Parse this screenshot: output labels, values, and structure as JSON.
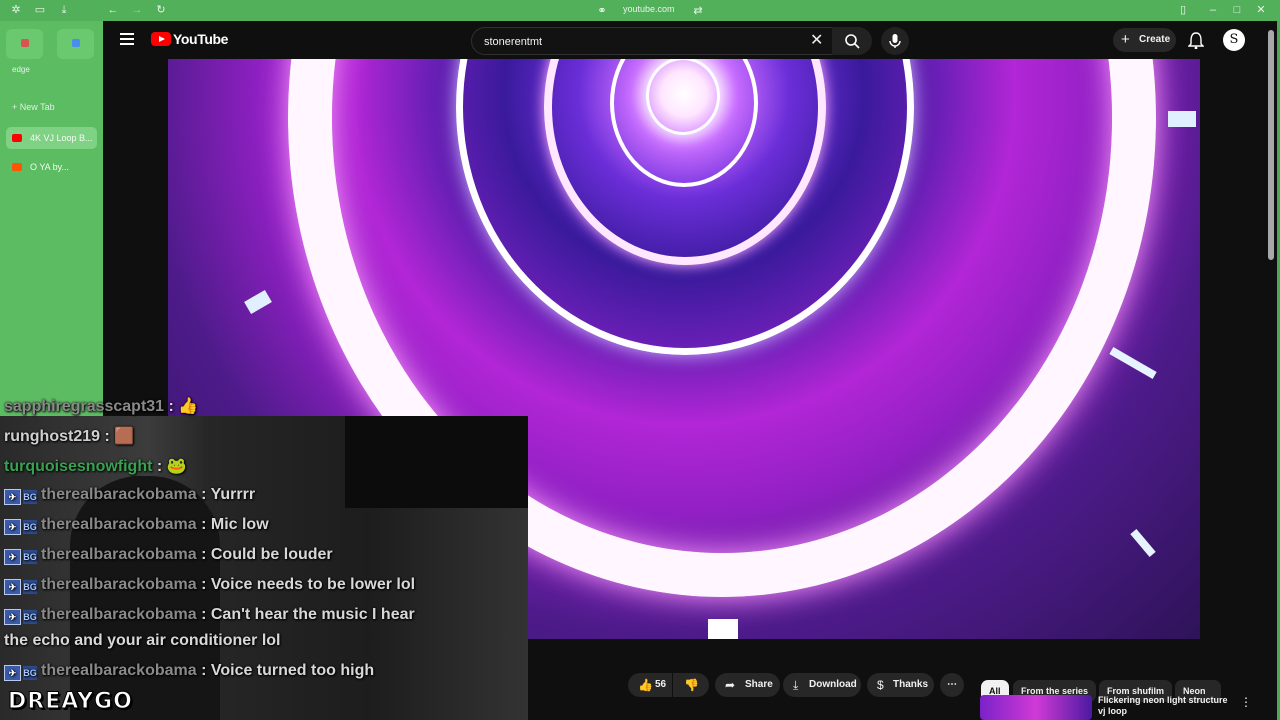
{
  "browser": {
    "url": "youtube.com",
    "sidebar_label": "edge",
    "new_tab_label": "New Tab",
    "tabs": [
      {
        "title": "4K VJ Loop B...",
        "color": "#ff0000"
      },
      {
        "title": "O YA by...",
        "color": "#ff5500"
      }
    ]
  },
  "youtube": {
    "logo_text": "YouTube",
    "search_value": "stonerentmt",
    "create_label": "Create",
    "avatar_letter": "S",
    "actions": {
      "likes": "56",
      "share": "Share",
      "download": "Download",
      "thanks": "Thanks"
    },
    "chips": [
      "All",
      "From the series",
      "From shufilm",
      "Neon"
    ],
    "recommended_title": "Flickering neon light structure vj loop"
  },
  "chat": [
    {
      "user": "sapphiregrasscapt31",
      "msg": "👍",
      "badges": false
    },
    {
      "user": "runghost219",
      "msg": "🟫",
      "badges": false
    },
    {
      "user": "turquoisesnowfight",
      "msg": "🐸",
      "badges": false
    },
    {
      "user": "therealbarackobama",
      "msg": "Yurrrr",
      "badges": true
    },
    {
      "user": "therealbarackobama",
      "msg": "Mic low",
      "badges": true
    },
    {
      "user": "therealbarackobama",
      "msg": "Could be louder",
      "badges": true
    },
    {
      "user": "therealbarackobama",
      "msg": "Voice needs to be lower lol",
      "badges": true
    },
    {
      "user": "therealbarackobama",
      "msg": "Can't hear the music I hear",
      "badges": true
    },
    {
      "continuation": "the echo and your air conditioner lol"
    },
    {
      "user": "therealbarackobama",
      "msg": "Voice turned too high",
      "badges": true
    }
  ],
  "streamer_name": "DREAYGO",
  "colors": {
    "browser_green": "#52b05b",
    "youtube_bg": "#0f0f0f",
    "youtube_red": "#ff0000",
    "chat_user_green": "#3aa152"
  }
}
